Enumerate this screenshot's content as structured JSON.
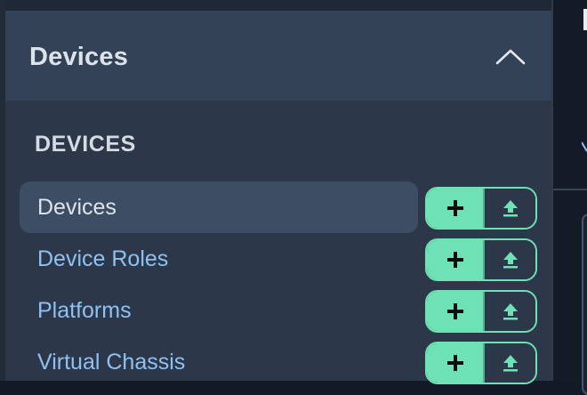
{
  "colors": {
    "accent": "#6ee2b4",
    "link": "#8ec1f2",
    "sidebar_bg": "#2c3849",
    "header_bg": "#344257",
    "active_bg": "#3d4d63"
  },
  "sidebar": {
    "section": {
      "title": "Devices",
      "toggle_icon": "chevron-up-icon",
      "expanded": true
    },
    "group": {
      "heading": "DEVICES",
      "items": [
        {
          "label": "Devices",
          "active": true,
          "add_icon": "plus-icon",
          "import_icon": "upload-icon"
        },
        {
          "label": "Device Roles",
          "active": false,
          "add_icon": "plus-icon",
          "import_icon": "upload-icon"
        },
        {
          "label": "Platforms",
          "active": false,
          "add_icon": "plus-icon",
          "import_icon": "upload-icon"
        },
        {
          "label": "Virtual Chassis",
          "active": false,
          "add_icon": "plus-icon",
          "import_icon": "upload-icon"
        }
      ]
    }
  }
}
